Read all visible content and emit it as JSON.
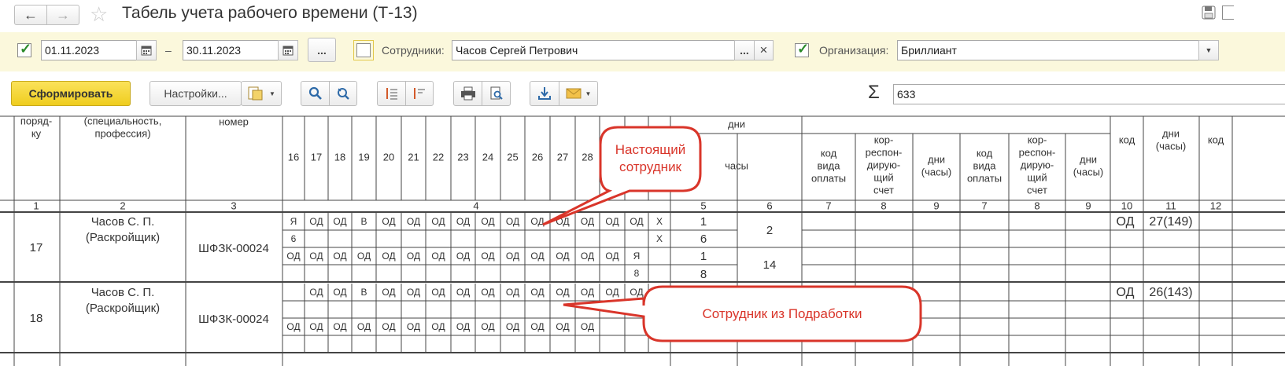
{
  "window": {
    "title": "Табель учета рабочего времени (Т-13)",
    "nav_back_icon": "arrow-left-icon",
    "nav_forward_icon": "arrow-right-icon",
    "favorite_icon": "star-icon",
    "save_icon": "floppy-icon"
  },
  "filters": {
    "period_enabled": true,
    "date_from": "01.11.2023",
    "date_separator": "–",
    "date_to": "30.11.2023",
    "period_button": "...",
    "employees_enabled": false,
    "employees_label": "Сотрудники:",
    "employees_value": "Часов Сергей Петрович",
    "employees_more": "...",
    "employees_clear": "×",
    "org_enabled": true,
    "org_label": "Организация:",
    "org_value": "Бриллиант"
  },
  "toolbar": {
    "generate": "Сформировать",
    "settings": "Настройки...",
    "sum_value": "633"
  },
  "report": {
    "header": {
      "col1": "поряд-\nку",
      "col2": "(специальность,\nпрофессия)",
      "col3": "номер",
      "days": [
        "16",
        "17",
        "18",
        "19",
        "20",
        "21",
        "22",
        "23",
        "24",
        "25",
        "26",
        "27",
        "28"
      ],
      "dni": "дни",
      "chasy": "часы",
      "kod_vida": "код\nвида\nоплаты",
      "korr": "кор-\nреспон-\nдирую-\nщий\nсчет",
      "dni_chasy": "дни\n(часы)",
      "kod": "код",
      "dni_chasy2": "дни\n(часы)",
      "kod2": "код",
      "nums": [
        "1",
        "2",
        "3",
        "4",
        "5",
        "6",
        "7",
        "8",
        "9",
        "7",
        "8",
        "9",
        "10",
        "11",
        "12"
      ]
    },
    "rows": [
      {
        "num": "17",
        "name": "Часов С. П.",
        "position": "(Раскройщик)",
        "tab": "ШФЗК-00024",
        "line1": [
          "Я",
          "ОД",
          "ОД",
          "В",
          "ОД",
          "ОД",
          "ОД",
          "ОД",
          "ОД",
          "ОД",
          "ОД",
          "ОД",
          "ОД",
          "ОД",
          "ОД",
          "Х"
        ],
        "line2": [
          "6",
          "",
          "",
          "",
          "",
          "",
          "",
          "",
          "",
          "",
          "",
          "",
          "",
          "",
          "",
          "Х"
        ],
        "line3": [
          "ОД",
          "ОД",
          "ОД",
          "ОД",
          "ОД",
          "ОД",
          "ОД",
          "ОД",
          "ОД",
          "ОД",
          "ОД",
          "ОД",
          "ОД",
          "ОД",
          "Я",
          ""
        ],
        "line4": [
          "",
          "",
          "",
          "",
          "",
          "",
          "",
          "",
          "",
          "",
          "",
          "",
          "",
          "",
          "8",
          ""
        ],
        "days1": "1",
        "hours1": "6",
        "total1": "2",
        "days2": "1",
        "hours2": "8",
        "total2": "14",
        "code": "ОД",
        "days_hours": "27(149)"
      },
      {
        "num": "18",
        "name": "Часов С. П.",
        "position": "(Раскройщик)",
        "tab": "ШФЗК-00024",
        "line1": [
          "",
          "ОД",
          "ОД",
          "В",
          "ОД",
          "ОД",
          "ОД",
          "ОД",
          "ОД",
          "ОД",
          "ОД",
          "ОД",
          "ОД",
          "ОД",
          "ОД",
          ""
        ],
        "line3": [
          "ОД",
          "ОД",
          "ОД",
          "ОД",
          "ОД",
          "ОД",
          "ОД",
          "ОД",
          "ОД",
          "ОД",
          "ОД",
          "ОД",
          "ОД",
          "",
          "",
          ""
        ],
        "code": "ОД",
        "days_hours": "26(143)"
      }
    ]
  },
  "callouts": {
    "real": "Настоящий\nсотрудник",
    "side": "Сотрудник из Подработки"
  },
  "colors": {
    "filter_bg": "#fbf8dc",
    "generate_bg": "#f5d632",
    "callout_border": "#d9352a",
    "check_green": "#2a8a2a"
  }
}
